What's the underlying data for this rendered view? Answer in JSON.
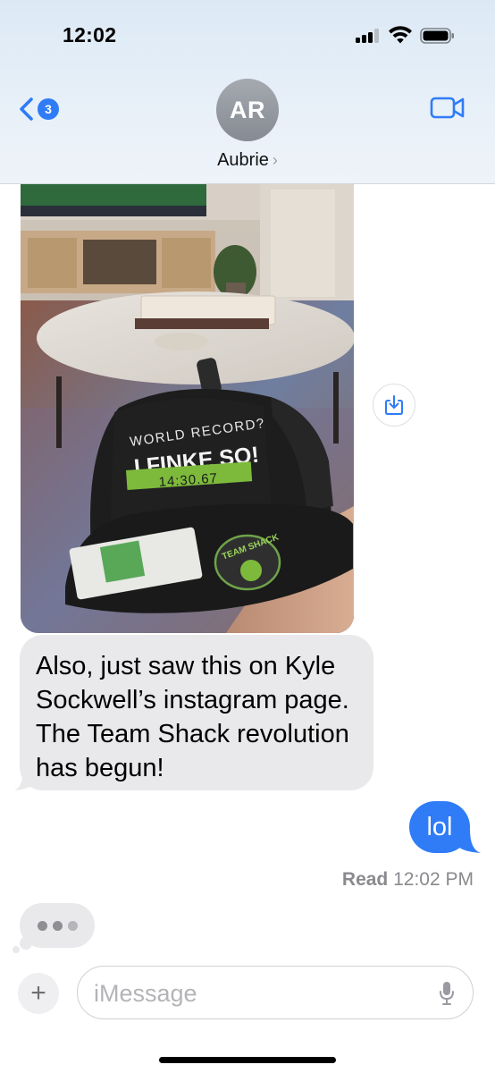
{
  "status_bar": {
    "time": "12:02"
  },
  "header": {
    "back_badge_count": "3",
    "avatar_initials": "AR",
    "contact_name": "Aubrie",
    "name_chevron": "›"
  },
  "photo": {
    "cap_line1": "WORLD RECORD?",
    "cap_line2": "I FINKE SO!",
    "cap_time": "14:30.67",
    "patch_text": "TEAM SHACK"
  },
  "messages": {
    "incoming_text": "Also, just saw this on Kyle Sockwell’s instagram page. The Team Shack revolution has begun!",
    "outgoing_text": "lol",
    "read_label": "Read",
    "read_time": "12:02 PM"
  },
  "input": {
    "placeholder": "iMessage",
    "plus_label": "+"
  },
  "colors": {
    "accent_blue": "#2f7cf6",
    "incoming_bubble": "#e9e9eb",
    "cap_green": "#7dba3c"
  },
  "icons": [
    "signal-icon",
    "wifi-icon",
    "battery-icon",
    "back-chevron-icon",
    "video-camera-icon",
    "save-download-icon",
    "plus-icon",
    "microphone-icon"
  ]
}
